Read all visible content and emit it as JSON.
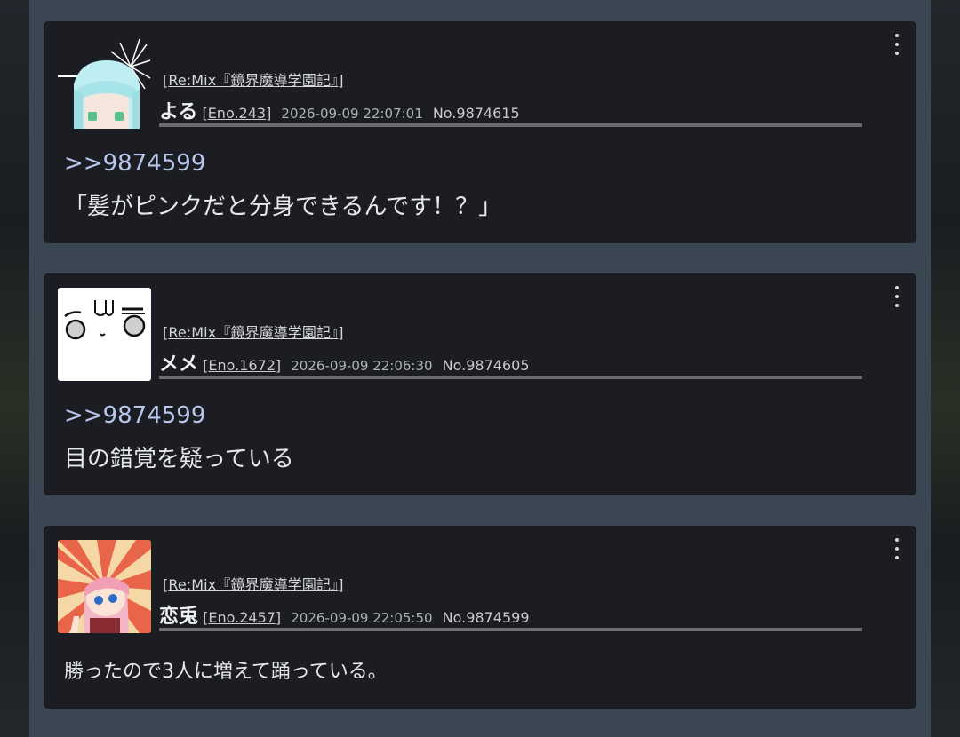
{
  "posts": [
    {
      "room": "Re:Mix『鏡界魔導学園記』",
      "name": "よる",
      "eno": "Eno.243",
      "date": "2026-09-09 22:07:01",
      "no": "No.9874615",
      "reply": ">>9874599",
      "text": "「髪がピンクだと分身できるんです！？」"
    },
    {
      "room": "Re:Mix『鏡界魔導学園記』",
      "name": "メメ",
      "eno": "Eno.1672",
      "date": "2026-09-09 22:06:30",
      "no": "No.9874605",
      "reply": ">>9874599",
      "text": "目の錯覚を疑っている"
    },
    {
      "room": "Re:Mix『鏡界魔導学園記』",
      "name": "恋兎",
      "eno": "Eno.2457",
      "date": "2026-09-09 22:05:50",
      "no": "No.9874599",
      "text": "勝ったので3人に増えて踊っている。"
    }
  ],
  "colors": {
    "column": "#3a4651",
    "card": "#1b1d22",
    "reply_link": "#b7c6ea"
  },
  "icons": [
    "more-vertical-icon"
  ]
}
